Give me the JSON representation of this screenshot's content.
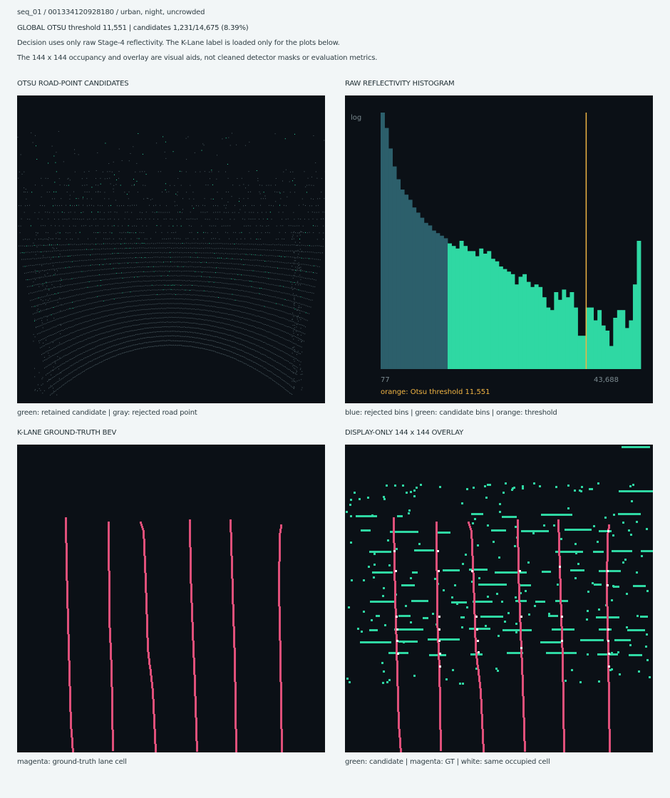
{
  "header": {
    "sequence": "seq_01 / 001334120928180 / urban, night, uncrowded",
    "otsu_line": "GLOBAL OTSU threshold 11,551  |  candidates 1,231/14,675 (8.39%)",
    "desc1": "Decision uses only raw Stage-4 reflectivity. The K-Lane label is loaded only for the plots below.",
    "desc2": "The 144 x 144 occupancy and overlay are visual aids, not cleaned detector masks or evaluation metrics."
  },
  "panels": {
    "candidates": {
      "title": "OTSU ROAD-POINT CANDIDATES",
      "caption": "green: retained candidate  |  gray: rejected road point"
    },
    "histogram": {
      "title": "RAW REFLECTIVITY HISTOGRAM",
      "caption": "blue: rejected bins  |  green: candidate bins  |  orange: threshold",
      "log_label": "log",
      "x_min_label": "77",
      "x_max_label": "43,688",
      "threshold_label": "orange: Otsu threshold 11,551"
    },
    "groundtruth": {
      "title": "K-LANE GROUND-TRUTH BEV",
      "caption": "magenta: ground-truth lane cell"
    },
    "overlay": {
      "title": "DISPLAY-ONLY 144 x 144 OVERLAY",
      "caption": "green: candidate  |  magenta: GT  |  white: same occupied cell"
    }
  },
  "colors": {
    "background": "#f2f6f7",
    "panel": "#0b1016",
    "candidate_green": "#2fd8a3",
    "rejected_blue": "#2c5f6b",
    "threshold_orange": "#f0b443",
    "gt_magenta": "#e0507a",
    "rejected_gray": "#3a4a50"
  },
  "chart_data": {
    "type": "bar",
    "title": "RAW REFLECTIVITY HISTOGRAM",
    "xlabel": "",
    "ylabel": "log",
    "x_range": [
      77,
      43688
    ],
    "y_scale": "log",
    "threshold": 11551,
    "bins": 66,
    "rejected_bins": 17,
    "values": [
      1.0,
      0.94,
      0.86,
      0.79,
      0.74,
      0.7,
      0.68,
      0.66,
      0.63,
      0.61,
      0.59,
      0.57,
      0.56,
      0.54,
      0.53,
      0.52,
      0.51,
      0.49,
      0.48,
      0.47,
      0.5,
      0.48,
      0.46,
      0.46,
      0.44,
      0.47,
      0.45,
      0.46,
      0.43,
      0.42,
      0.4,
      0.39,
      0.38,
      0.37,
      0.33,
      0.36,
      0.37,
      0.34,
      0.32,
      0.33,
      0.32,
      0.28,
      0.24,
      0.23,
      0.3,
      0.27,
      0.31,
      0.28,
      0.3,
      0.24,
      0.13,
      0.13,
      0.24,
      0.24,
      0.19,
      0.23,
      0.17,
      0.15,
      0.09,
      0.2,
      0.23,
      0.23,
      0.16,
      0.19,
      0.33,
      0.5
    ]
  }
}
